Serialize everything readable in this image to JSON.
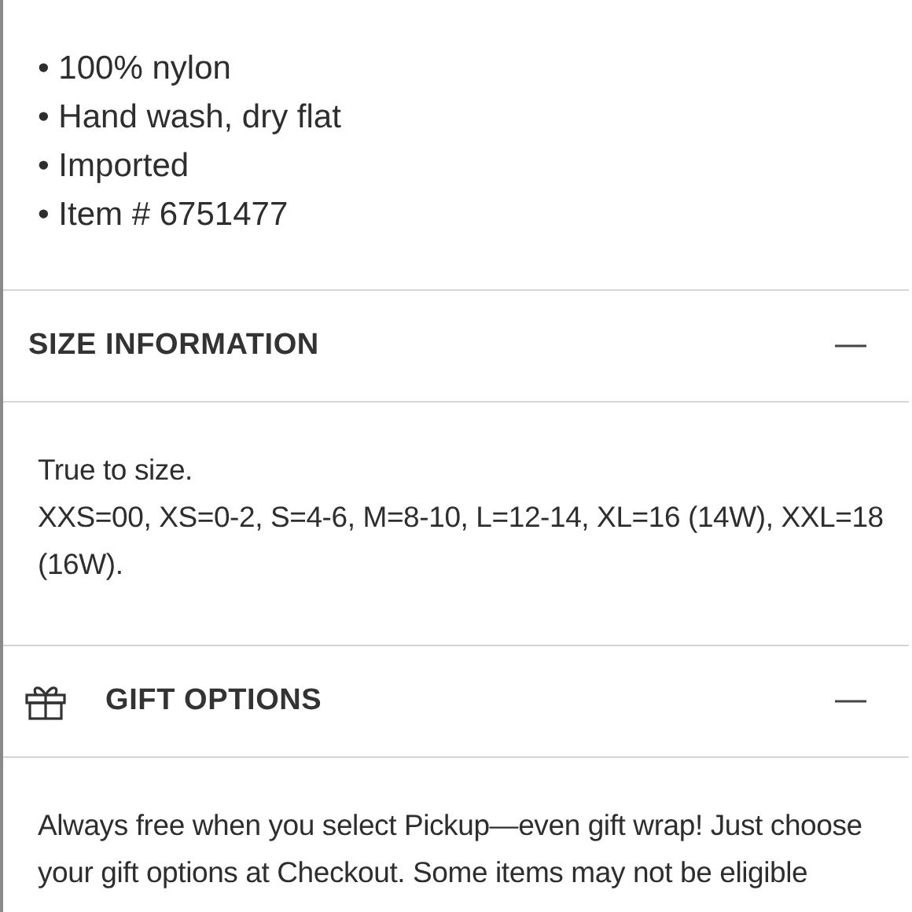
{
  "details": [
    "• 100% nylon",
    "• Hand wash, dry flat",
    "• Imported",
    "• Item # 6751477"
  ],
  "sections": [
    {
      "kind": "text",
      "title": "SIZE INFORMATION",
      "expanded": true,
      "paragraphs": [
        "True to size.",
        "XXS=00, XS=0-2, S=4-6, M=8-10, L=12-14, XL=16 (14W), XXL=18 (16W)."
      ]
    },
    {
      "kind": "gift",
      "title": "GIFT OPTIONS",
      "expanded": true,
      "paragraphs": [
        "Always free when you select Pickup—even gift wrap! Just choose your gift options at Checkout. Some items may not be eligible"
      ]
    }
  ]
}
